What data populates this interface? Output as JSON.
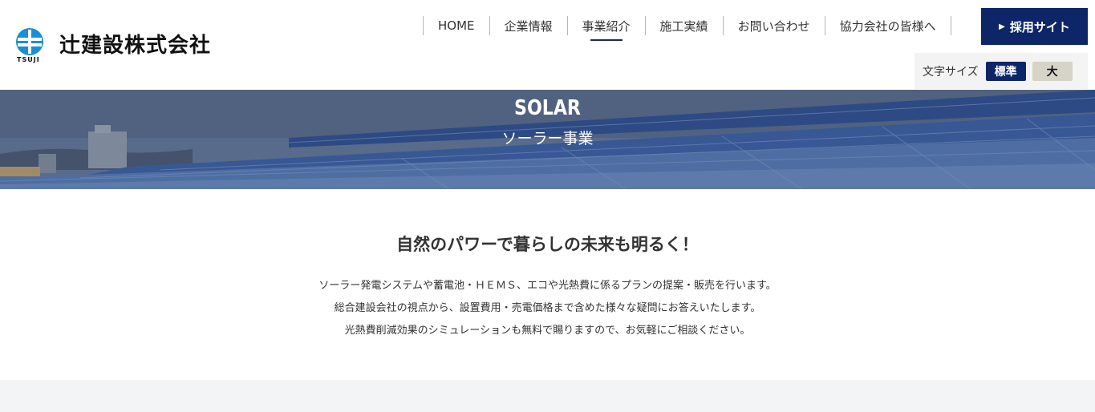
{
  "logo": {
    "company_name": "辻建設株式会社",
    "mark_text": "TSUJI"
  },
  "nav": {
    "items": [
      {
        "label": "HOME"
      },
      {
        "label": "企業情報"
      },
      {
        "label": "事業紹介",
        "active": true
      },
      {
        "label": "施工実績"
      },
      {
        "label": "お問い合わせ"
      },
      {
        "label": "協力会社の皆様へ"
      }
    ]
  },
  "recruit": {
    "label": "採用サイト",
    "icon": "play-triangle-icon"
  },
  "font_size": {
    "label": "文字サイズ",
    "standard": "標準",
    "large": "大"
  },
  "hero": {
    "title": "SOLAR",
    "subtitle": "ソーラー事業"
  },
  "main": {
    "heading": "自然のパワーで暮らしの未来も明るく！",
    "paragraphs": [
      "ソーラー発電システムや蓄電池・ＨＥＭＳ、エコや光熱費に係るプランの提案・販売を行います。",
      "総合建設会社の視点から、設置費用・売電価格まで含めた様々な疑問にお答えいたします。",
      "光熱費削減効果のシミュレーションも無料で賜りますので、お気軽にご相談ください。"
    ]
  },
  "colors": {
    "navy": "#0c2667",
    "large_btn": "#d6d3c9",
    "footer_band": "#f3f4f6"
  }
}
